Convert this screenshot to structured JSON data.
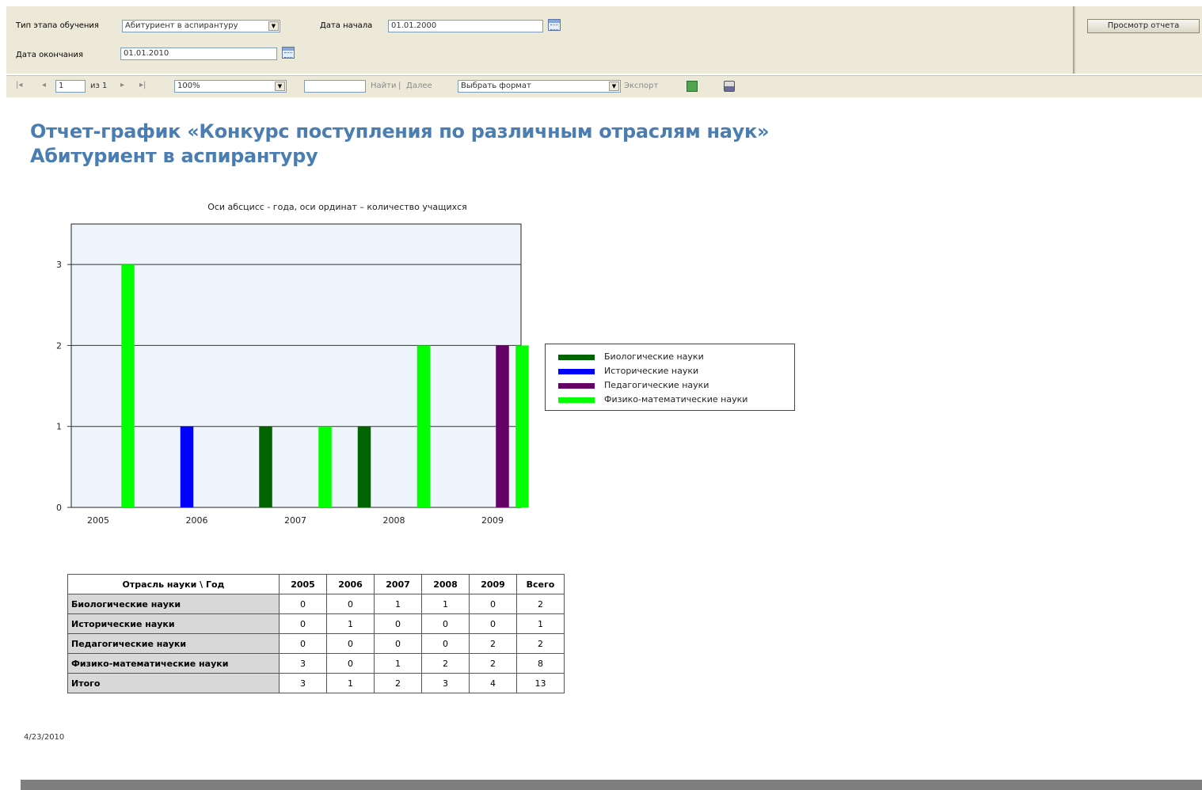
{
  "params": {
    "stage_label": "Тип этапа обучения",
    "stage_value": "Абитуриент в аспирантуру",
    "start_label": "Дата начала",
    "start_value": "01.01.2000",
    "end_label": "Дата окончания",
    "end_value": "01.01.2010",
    "view_report": "Просмотр отчета"
  },
  "toolbar": {
    "page_value": "1",
    "of_pages": "из 1",
    "zoom": "100%",
    "find_value": "",
    "find": "Найти",
    "separator": "|",
    "next": "Далее",
    "format": "Выбрать формат",
    "export": "Экспорт"
  },
  "report": {
    "title_line1": "Отчет-график «Конкурс поступления по различным отраслям наук»",
    "title_line2": "Абитуриент в аспирантуру",
    "date": "4/23/2010"
  },
  "chart_data": {
    "type": "bar",
    "title": "Оси абсцисс - года, оси ординат – количество учащихся",
    "categories": [
      "2005",
      "2006",
      "2007",
      "2008",
      "2009"
    ],
    "ylim": [
      0,
      3.5
    ],
    "yticks": [
      0,
      1,
      2,
      3
    ],
    "grid": true,
    "legend_position": "right",
    "series": [
      {
        "name": "Биологические науки",
        "color": "#006400",
        "values": [
          0,
          0,
          1,
          1,
          0
        ]
      },
      {
        "name": "Исторические науки",
        "color": "#0000ff",
        "values": [
          0,
          1,
          0,
          0,
          0
        ]
      },
      {
        "name": "Педагогические науки",
        "color": "#660066",
        "values": [
          0,
          0,
          0,
          0,
          2
        ]
      },
      {
        "name": "Физико-математические науки",
        "color": "#00ff00",
        "values": [
          3,
          0,
          1,
          2,
          2
        ]
      }
    ]
  },
  "table": {
    "corner": "Отрасль науки \\ Год",
    "headers": [
      "2005",
      "2006",
      "2007",
      "2008",
      "2009",
      "Всего"
    ],
    "rows": [
      {
        "label": "Биологические науки",
        "values": [
          "0",
          "0",
          "1",
          "1",
          "0",
          "2"
        ]
      },
      {
        "label": "Исторические науки",
        "values": [
          "0",
          "1",
          "0",
          "0",
          "0",
          "1"
        ]
      },
      {
        "label": "Педагогические науки",
        "values": [
          "0",
          "0",
          "0",
          "0",
          "2",
          "2"
        ]
      },
      {
        "label": "Физико-математические науки",
        "values": [
          "3",
          "0",
          "1",
          "2",
          "2",
          "8"
        ]
      },
      {
        "label": "Итого",
        "values": [
          "3",
          "1",
          "2",
          "3",
          "4",
          "13"
        ]
      }
    ]
  }
}
